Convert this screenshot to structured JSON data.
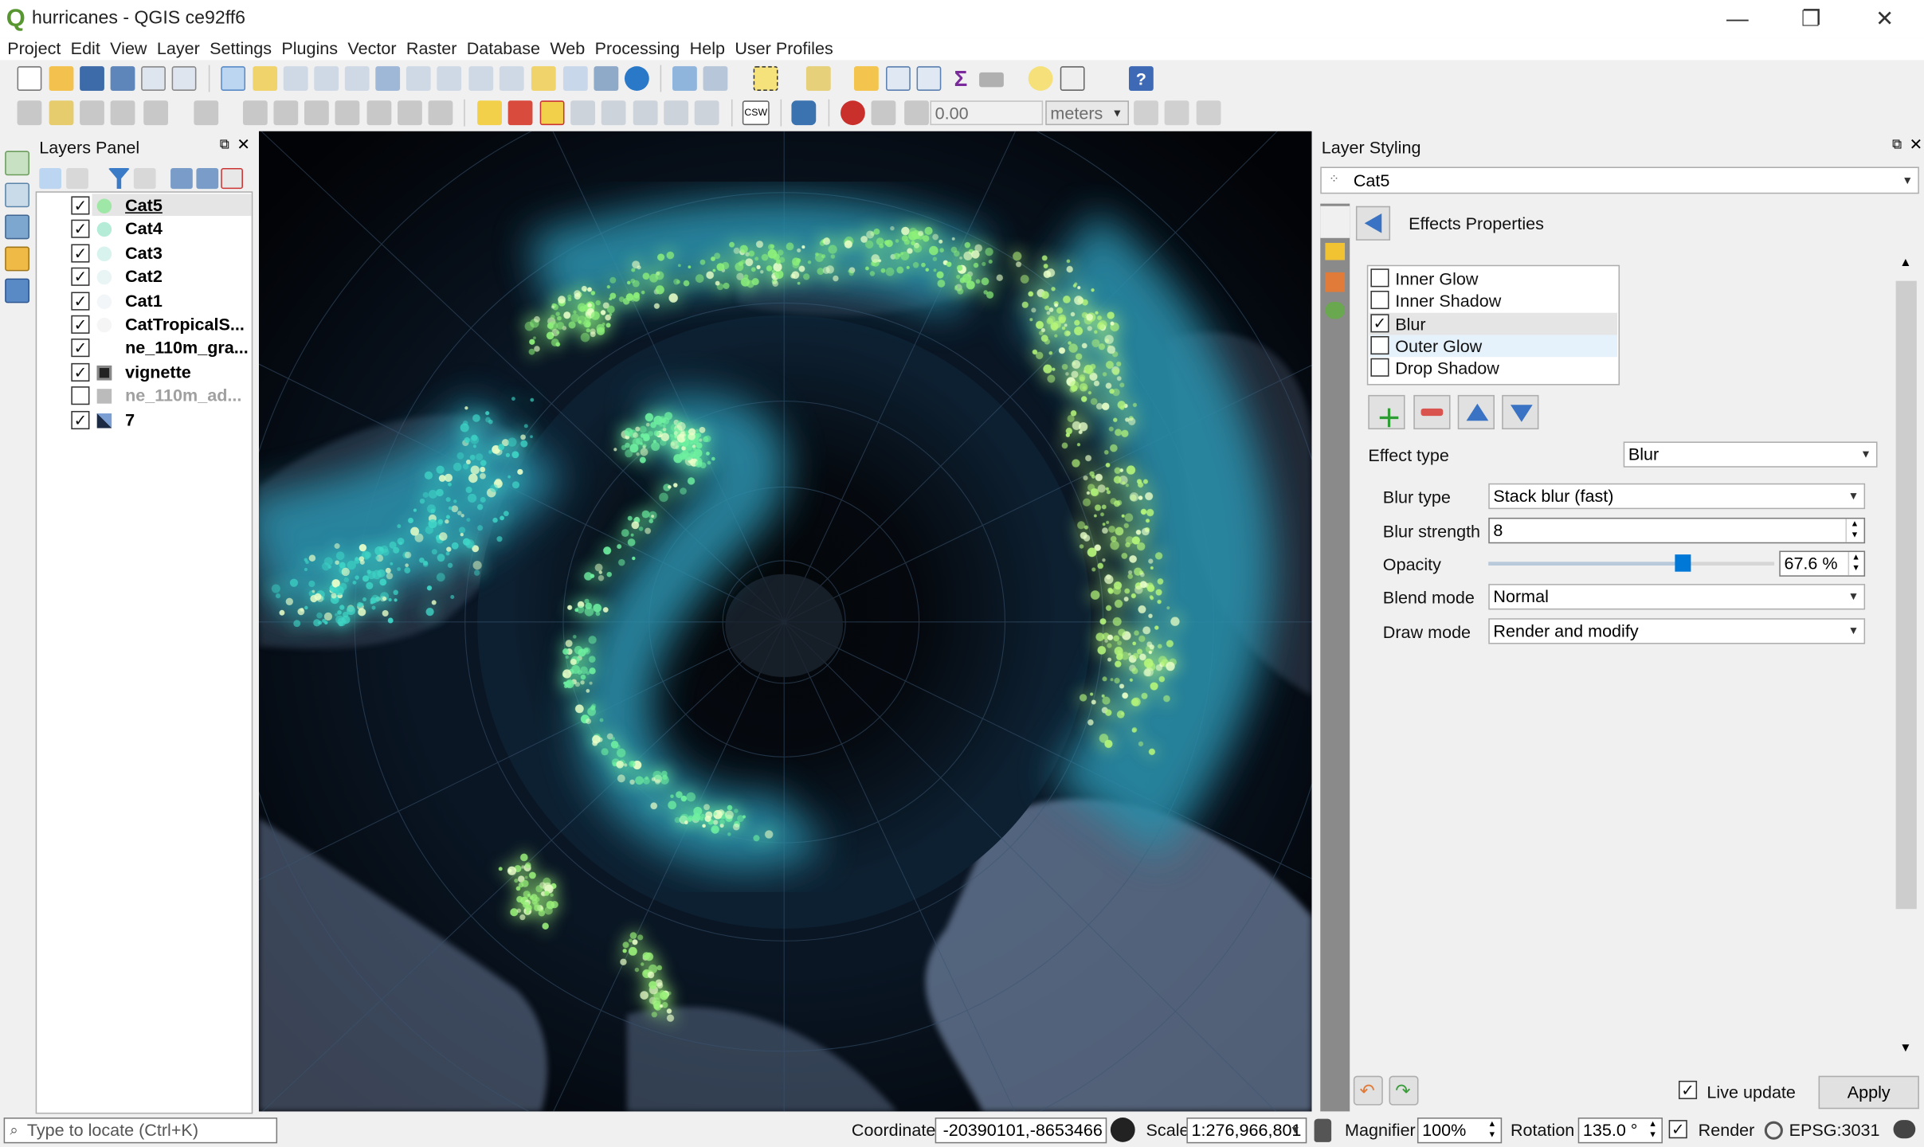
{
  "window": {
    "title": "hurricanes - QGIS ce92ff6",
    "app_logo_letter": "Q",
    "minimize": "—",
    "restore": "❐",
    "close": "✕"
  },
  "menu": [
    "Project",
    "Edit",
    "View",
    "Layer",
    "Settings",
    "Plugins",
    "Vector",
    "Raster",
    "Database",
    "Web",
    "Processing",
    "Help",
    "User Profiles"
  ],
  "digitize_toolbar": {
    "snap_value": "0.00",
    "units": "meters",
    "csw_label": "CSW"
  },
  "layers_panel": {
    "title": "Layers Panel",
    "layers": [
      {
        "name": "Cat5",
        "checked": "✓",
        "style": "bold underline",
        "dot": "#9fe7a6"
      },
      {
        "name": "Cat4",
        "checked": "✓",
        "style": "bold",
        "dot": "#b5ecd8"
      },
      {
        "name": "Cat3",
        "checked": "✓",
        "style": "bold",
        "dot": "#d8f2ee"
      },
      {
        "name": "Cat2",
        "checked": "✓",
        "style": "bold",
        "dot": "#e9f5f5"
      },
      {
        "name": "Cat1",
        "checked": "✓",
        "style": "bold",
        "dot": "#f3f6f8"
      },
      {
        "name": "CatTropicalS...",
        "checked": "✓",
        "style": "bold",
        "dot": "#f5f5f5"
      },
      {
        "name": "ne_110m_gra...",
        "checked": "✓",
        "style": "bold",
        "dot": ""
      },
      {
        "name": "vignette",
        "checked": "✓",
        "style": "bold",
        "dot": "raster"
      },
      {
        "name": "ne_110m_ad...",
        "checked": "",
        "style": "bold grey",
        "dot": "raster-grey"
      },
      {
        "name": "7",
        "checked": "✓",
        "style": "bold",
        "dot": "raster-checker"
      }
    ]
  },
  "layer_styling": {
    "title": "Layer Styling",
    "current_layer": "Cat5",
    "section_title": "Effects Properties",
    "effects": [
      {
        "label": "Inner Glow",
        "checked": ""
      },
      {
        "label": "Inner Shadow",
        "checked": ""
      },
      {
        "label": "Blur",
        "checked": "✓"
      },
      {
        "label": "Outer Glow",
        "checked": ""
      },
      {
        "label": "Drop Shadow",
        "checked": ""
      }
    ],
    "effect_type_label": "Effect type",
    "effect_type_value": "Blur",
    "blur_type_label": "Blur type",
    "blur_type_value": "Stack blur (fast)",
    "blur_strength_label": "Blur strength",
    "blur_strength_value": "8",
    "opacity_label": "Opacity",
    "opacity_value": "67.6 %",
    "opacity_fraction": 0.676,
    "blend_mode_label": "Blend mode",
    "blend_mode_value": "Normal",
    "draw_mode_label": "Draw mode",
    "draw_mode_value": "Render and modify",
    "live_update_label": "Live update",
    "live_update_checked": "✓",
    "apply_label": "Apply"
  },
  "statusbar": {
    "locator_placeholder": "Type to locate (Ctrl+K)",
    "coordinate_label": "Coordinate",
    "coordinate_value": "-20390101,-8653466",
    "scale_label": "Scale",
    "scale_value": "1:276,966,801",
    "magnifier_label": "Magnifier",
    "magnifier_value": "100%",
    "rotation_label": "Rotation",
    "rotation_value": "135.0 °",
    "render_label": "Render",
    "render_checked": "✓",
    "crs": "EPSG:3031"
  },
  "colors": {
    "map_background": "#05080f",
    "hurricane_glow": "#9cf57a",
    "hurricane_cyan": "#49c3d2",
    "land": "#7b8da8"
  }
}
